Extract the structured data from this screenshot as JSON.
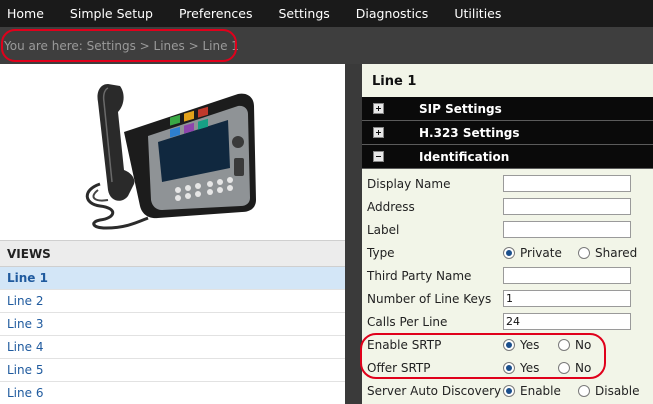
{
  "nav": {
    "items": [
      "Home",
      "Simple Setup",
      "Preferences",
      "Settings",
      "Diagnostics",
      "Utilities"
    ]
  },
  "breadcrumb": "You are here: Settings > Lines > Line 1",
  "views": {
    "heading": "VIEWS",
    "items": [
      "Line 1",
      "Line 2",
      "Line 3",
      "Line 4",
      "Line 5",
      "Line 6"
    ],
    "active_index": 0
  },
  "panel": {
    "title": "Line 1",
    "sections": [
      {
        "label": "SIP Settings",
        "state": "collapsed"
      },
      {
        "label": "H.323 Settings",
        "state": "collapsed"
      },
      {
        "label": "Identification",
        "state": "expanded"
      }
    ],
    "fields": {
      "display_name": {
        "label": "Display Name",
        "value": ""
      },
      "address": {
        "label": "Address",
        "value": ""
      },
      "label": {
        "label": "Label",
        "value": ""
      },
      "type": {
        "label": "Type",
        "options": [
          "Private",
          "Shared"
        ],
        "selected": "Private"
      },
      "third_party_name": {
        "label": "Third Party Name",
        "value": ""
      },
      "number_of_line_keys": {
        "label": "Number of Line Keys",
        "value": "1"
      },
      "calls_per_line": {
        "label": "Calls Per Line",
        "value": "24"
      },
      "enable_srtp": {
        "label": "Enable SRTP",
        "options": [
          "Yes",
          "No"
        ],
        "selected": "Yes"
      },
      "offer_srtp": {
        "label": "Offer SRTP",
        "options": [
          "Yes",
          "No"
        ],
        "selected": "Yes"
      },
      "server_auto_discovery": {
        "label": "Server Auto Discovery",
        "options": [
          "Enable",
          "Disable"
        ],
        "selected": "Enable"
      }
    }
  },
  "colors": {
    "nav_bg": "#1a1a1a",
    "link": "#1f5a9e",
    "active_row": "#d3e6f7",
    "panel_bg": "#f2f5e8",
    "highlight": "#e0001b"
  }
}
